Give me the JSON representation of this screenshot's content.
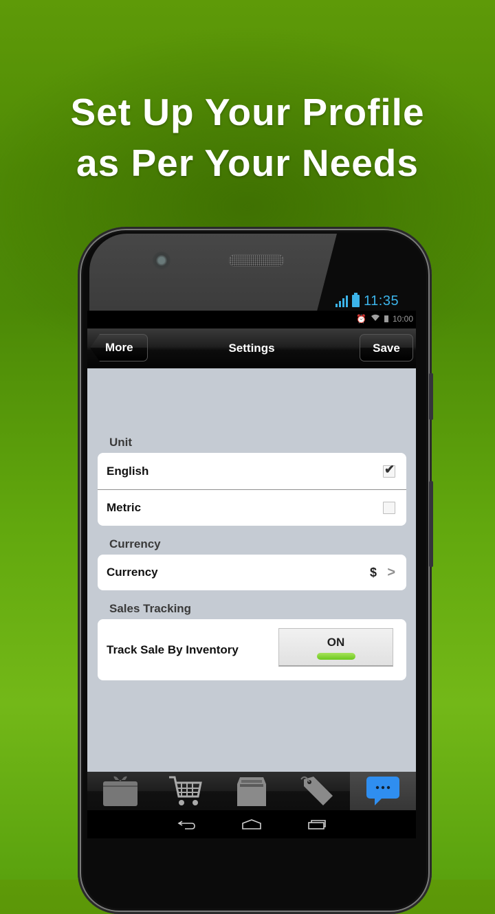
{
  "headline": {
    "line1": "Set Up Your Profile",
    "line2": "as Per Your Needs"
  },
  "device": {
    "lock_time": "11:35",
    "status_time": "10:00",
    "status_icons": [
      "alarm-icon",
      "wifi-icon",
      "battery-icon"
    ]
  },
  "navbar": {
    "back_label": "More",
    "title": "Settings",
    "save_label": "Save"
  },
  "sections": {
    "unit": {
      "label": "Unit",
      "options": [
        {
          "label": "English",
          "checked": true
        },
        {
          "label": "Metric",
          "checked": false
        }
      ]
    },
    "currency": {
      "label": "Currency",
      "row_label": "Currency",
      "value": "$"
    },
    "sales_tracking": {
      "label": "Sales Tracking",
      "row_label": "Track Sale By Inventory",
      "toggle_label": "ON",
      "toggle_on": true
    }
  },
  "tabbar": {
    "tabs": [
      {
        "icon": "gift-icon",
        "active": false
      },
      {
        "icon": "cart-icon",
        "active": false
      },
      {
        "icon": "inventory-box-icon",
        "active": false
      },
      {
        "icon": "price-tag-icon",
        "active": false
      },
      {
        "icon": "more-chat-icon",
        "active": true
      }
    ]
  },
  "system_nav": [
    "back-icon",
    "home-icon",
    "recent-apps-icon"
  ],
  "colors": {
    "background_green": "#5a9a08",
    "status_blue": "#3cb4ea",
    "toggle_green": "#7dd12a",
    "content_bg": "#c5cbd3",
    "active_tab_blue": "#2f8ef0"
  }
}
